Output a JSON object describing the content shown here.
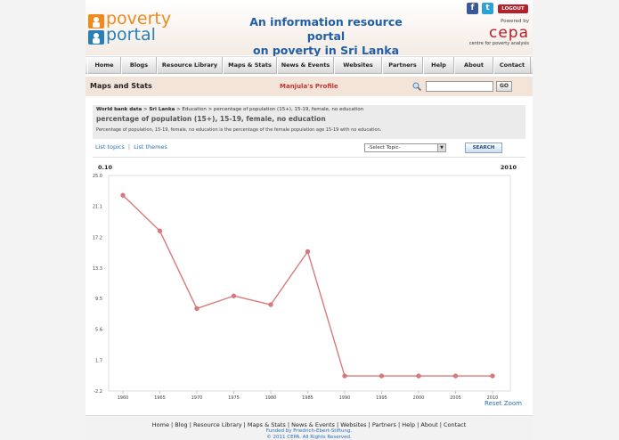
{
  "header": {
    "logo_line1": "poverty",
    "logo_line2": "portal",
    "tagline_line1": "An information resource portal",
    "tagline_line2": "on poverty in Sri Lanka",
    "facebook_glyph": "f",
    "twitter_glyph": "t",
    "logout_label": "LOGOUT",
    "powered_by": "Powered by",
    "cepa_word": "cepa",
    "cepa_sub": "centre for poverty analysis"
  },
  "nav": {
    "items": [
      {
        "label": "Home"
      },
      {
        "label": "Blogs"
      },
      {
        "label": "Resource Library"
      },
      {
        "label": "Maps & Stats"
      },
      {
        "label": "News & Events"
      },
      {
        "label": "Websites"
      },
      {
        "label": "Partners"
      },
      {
        "label": "Help"
      },
      {
        "label": "About"
      },
      {
        "label": "Contact"
      }
    ]
  },
  "section": {
    "title": "Maps and Stats",
    "profile": "Manjula's Profile",
    "search_value": "",
    "go_label": "GO"
  },
  "info": {
    "crumb_root": "World bank data",
    "crumb_sep1": " > ",
    "crumb_country": "Sri Lanka",
    "crumb_rest": " > Education > percentage of population (15+), 15-19, female, no education",
    "indicator": "percentage of population (15+), 15-19, female, no education",
    "description": "Percentage of population, 15-19, female, no education is the percentage of the female population age 15-19 with no education."
  },
  "tools": {
    "list_topics": "List topics",
    "separator": "|",
    "list_themes": "List themes",
    "select_value": "-Select Topic-",
    "search_label": "SEARCH"
  },
  "chart_data": {
    "type": "line",
    "corner_left": "0.10",
    "corner_right": "2010",
    "x": [
      1960,
      1965,
      1970,
      1975,
      1980,
      1985,
      1990,
      1995,
      2000,
      2005,
      2010
    ],
    "values": [
      22.5,
      18.0,
      8.2,
      9.8,
      8.7,
      15.4,
      -0.3,
      -0.3,
      -0.3,
      -0.3,
      -0.3
    ],
    "y_ticks": [
      "25.0",
      "21.1",
      "17.2",
      "13.3",
      "9.5",
      "5.6",
      "1.7",
      "-2.2"
    ],
    "ylim": [
      -2.2,
      25.0
    ],
    "x_ticks": [
      "1960",
      "1965",
      "1970",
      "1975",
      "1980",
      "1985",
      "1990",
      "1995",
      "2000",
      "2005",
      "2010"
    ],
    "color": "#d9797c",
    "grid": false,
    "reset_zoom": "Reset Zoom"
  },
  "footer": {
    "links": [
      {
        "label": "Home"
      },
      {
        "label": "Blog"
      },
      {
        "label": "Resource Library"
      },
      {
        "label": "Maps & Stats"
      },
      {
        "label": "News & Events"
      },
      {
        "label": "Websites"
      },
      {
        "label": "Partners"
      },
      {
        "label": "Help"
      },
      {
        "label": "About"
      },
      {
        "label": "Contact"
      }
    ],
    "funded": "Funded by Friedrich-Ebert-Stiftung.",
    "copyright": "© 2011 CEPA. All Rights Reserved."
  }
}
